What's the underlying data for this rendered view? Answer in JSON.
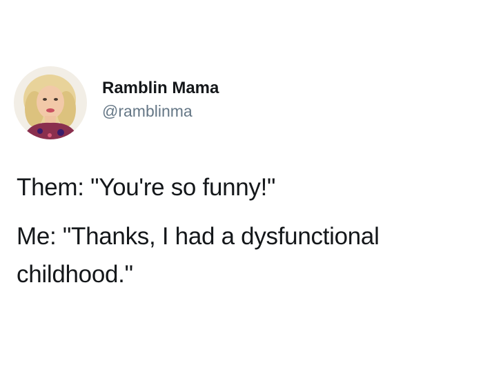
{
  "tweet": {
    "author": {
      "display_name": "Ramblin Mama",
      "handle": "@ramblinma",
      "avatar_icon": "profile-photo"
    },
    "lines": [
      "Them: \"You're so funny!\"",
      "Me: \"Thanks, I had a dysfunctional childhood.\""
    ]
  },
  "colors": {
    "text": "#14171a",
    "handle": "#657786",
    "background": "#ffffff"
  }
}
